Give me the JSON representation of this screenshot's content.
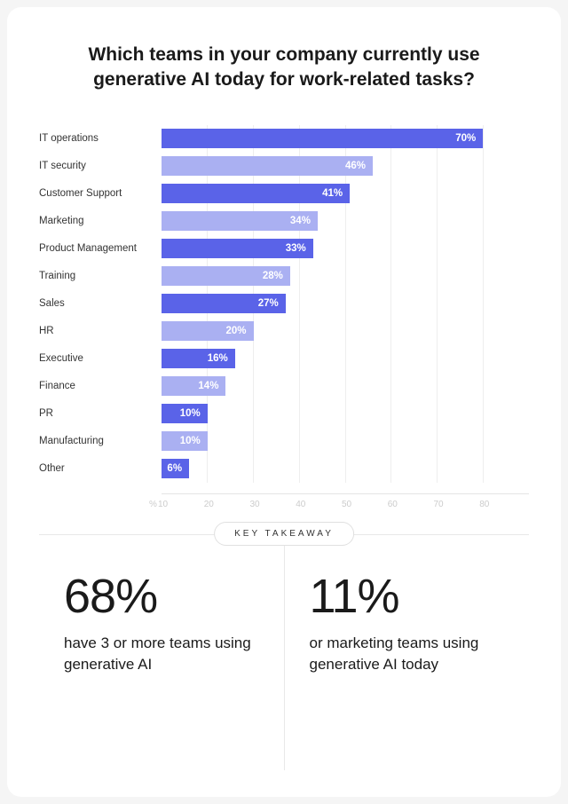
{
  "title": "Which teams in your company currently use generative AI today for work-related tasks?",
  "chart_data": {
    "type": "bar",
    "orientation": "horizontal",
    "categories": [
      "IT operations",
      "IT security",
      "Customer Support",
      "Marketing",
      "Product Management",
      "Training",
      "Sales",
      "HR",
      "Executive",
      "Finance",
      "PR",
      "Manufacturing",
      "Other"
    ],
    "values": [
      70,
      46,
      41,
      34,
      33,
      28,
      27,
      20,
      16,
      14,
      10,
      10,
      6
    ],
    "value_suffix": "%",
    "xlabel": "%",
    "ylabel": "",
    "xlim": [
      0,
      80
    ],
    "x_ticks": [
      10,
      20,
      30,
      40,
      50,
      60,
      70,
      80
    ],
    "colors_alt": [
      "dark",
      "light",
      "dark",
      "light",
      "dark",
      "light",
      "dark",
      "light",
      "dark",
      "light",
      "dark",
      "light",
      "dark"
    ],
    "palette": {
      "dark": "#5a63e8",
      "light": "#aab0f2"
    }
  },
  "takeaway": {
    "label": "KEY TAKEAWAY",
    "left": {
      "number": "68%",
      "text": "have 3 or more teams using generative AI"
    },
    "right": {
      "number": "11%",
      "text": "or marketing teams using generative AI today"
    }
  }
}
